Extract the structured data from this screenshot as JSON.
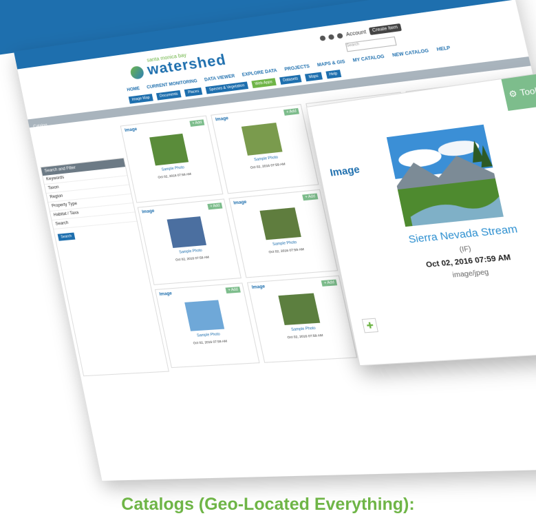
{
  "colors": {
    "brand_blue": "#1e6fae",
    "brand_green": "#6fb547",
    "add_green": "#7dbd8c"
  },
  "app": {
    "logo_text": "watershed",
    "logo_sub": "santa monica bay"
  },
  "utility": {
    "user": "Account",
    "button": "Create Item",
    "search_placeholder": "Search"
  },
  "nav": {
    "primary": [
      "HOME",
      "CURRENT MONITORING",
      "DATA VIEWER",
      "EXPLORE DATA",
      "PROJECTS",
      "MAPS & GIS",
      "MY CATALOG",
      "NEW CATALOG",
      "HELP"
    ],
    "secondary": [
      "Image Map",
      "Documents",
      "Places",
      "Species & Vegetation",
      "Web Apps",
      "Datasets",
      "Maps",
      "Help"
    ]
  },
  "graybar": {
    "label": "Catalog"
  },
  "sidebar": {
    "title": "Search and Filter",
    "rows": [
      "Keywords",
      "Taxon",
      "Region",
      "Property Type",
      "Habitat / Taxa",
      "Search"
    ],
    "go_label": "Search"
  },
  "cards": [
    {
      "label": "Image",
      "add": "+ Add",
      "caption": "Sample Photo",
      "meta": "Oct 02, 2016 07:59 AM",
      "color": "#5a8c3a"
    },
    {
      "label": "Image",
      "add": "+ Add",
      "caption": "Sample Photo",
      "meta": "Oct 02, 2016 07:59 AM",
      "color": "#7a9b4d"
    },
    {
      "label": "Image",
      "add": "+ Add",
      "caption": "Sample Photo",
      "meta": "Oct 02, 2016 07:59 AM",
      "color": "#8aa6b8"
    },
    {
      "label": "Image",
      "add": "+ Add",
      "caption": "Sample Photo",
      "meta": "Oct 02, 2016 07:59 AM",
      "color": "#b04a3a"
    },
    {
      "label": "Image",
      "add": "+ Add",
      "caption": "Sample Photo",
      "meta": "Oct 02, 2016 07:59 AM",
      "color": "#4b6fa0"
    },
    {
      "label": "Image",
      "add": "+ Add",
      "caption": "Sample Photo",
      "meta": "Oct 02, 2016 07:59 AM",
      "color": "#5f7d3e"
    },
    {
      "label": "Image",
      "add": "+ Add",
      "caption": "Sample Photo",
      "meta": "Oct 02, 2016 07:59 AM",
      "color": "#9b8f6a"
    },
    {
      "label": "Image",
      "add": "+ Add",
      "caption": "Sample Photo",
      "meta": "Oct 02, 2016 07:59 AM",
      "color": "#6a9a5a"
    },
    {
      "label": "Image",
      "add": "+ Add",
      "caption": "Sample Photo",
      "meta": "Oct 02, 2016 07:59 AM",
      "color": "#6fa8d8"
    },
    {
      "label": "Image",
      "add": "+ Add",
      "caption": "Sample Photo",
      "meta": "Oct 02, 2016 07:59 AM",
      "color": "#5c7f3f"
    },
    {
      "label": "Image",
      "add": "+ Add",
      "caption": "Sample Photo",
      "meta": "Oct 02, 2016 07:59 AM",
      "color": "#b9b09a"
    },
    {
      "label": "Image",
      "add": "+ Add",
      "caption": "Sample Photo",
      "meta": "Oct 02, 2016 07:59 AM",
      "color": "#c0563f"
    }
  ],
  "popout": {
    "title": "Image",
    "tools": "Tools",
    "name": "Sierra Nevada Stream",
    "author": "(IF)",
    "date": "Oct 02, 2016 07:59 AM",
    "type": "image/jpeg",
    "map_icon": "map-icon"
  },
  "caption": "Catalogs (Geo-Located Everything):"
}
